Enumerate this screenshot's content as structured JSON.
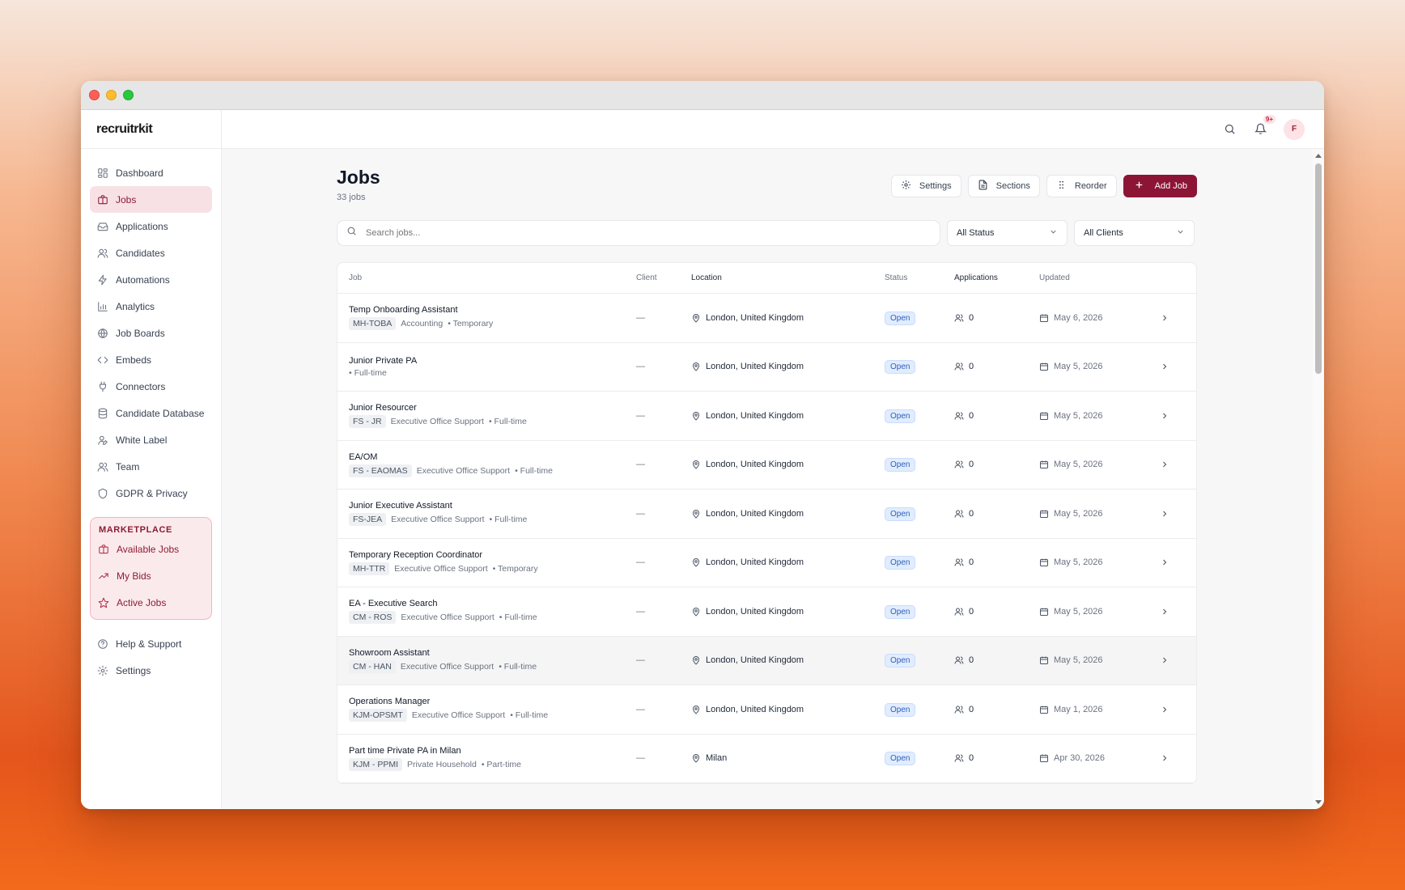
{
  "app": {
    "logo": "recruitrkit"
  },
  "sidebar": {
    "items": [
      {
        "label": "Dashboard",
        "icon": "dashboard-icon"
      },
      {
        "label": "Jobs",
        "icon": "briefcase-icon",
        "active": true
      },
      {
        "label": "Applications",
        "icon": "inbox-icon"
      },
      {
        "label": "Candidates",
        "icon": "users-icon"
      },
      {
        "label": "Automations",
        "icon": "lightning-icon"
      },
      {
        "label": "Analytics",
        "icon": "bar-chart-icon"
      },
      {
        "label": "Job Boards",
        "icon": "globe-icon"
      },
      {
        "label": "Embeds",
        "icon": "code-icon"
      },
      {
        "label": "Connectors",
        "icon": "plug-icon"
      },
      {
        "label": "Candidate Database",
        "icon": "database-icon"
      },
      {
        "label": "White Label",
        "icon": "user-pen-icon"
      },
      {
        "label": "Team",
        "icon": "team-icon"
      },
      {
        "label": "GDPR & Privacy",
        "icon": "shield-icon"
      }
    ],
    "marketplace": {
      "title": "MARKETPLACE",
      "items": [
        {
          "label": "Available Jobs",
          "icon": "briefcase-icon"
        },
        {
          "label": "My Bids",
          "icon": "trending-up-icon"
        },
        {
          "label": "Active Jobs",
          "icon": "star-icon"
        }
      ]
    },
    "bottom": [
      {
        "label": "Help & Support",
        "icon": "help-circle-icon"
      },
      {
        "label": "Settings",
        "icon": "gear-icon"
      }
    ]
  },
  "topbar": {
    "notifications_badge": "9+",
    "avatar_initial": "F"
  },
  "page": {
    "title": "Jobs",
    "subtitle": "33 jobs",
    "actions": {
      "settings": "Settings",
      "sections": "Sections",
      "reorder": "Reorder",
      "add": "Add Job"
    },
    "search_placeholder": "Search jobs...",
    "status_filter": "All Status",
    "client_filter": "All Clients"
  },
  "table": {
    "columns": {
      "job": "Job",
      "client": "Client",
      "location": "Location",
      "status": "Status",
      "applications": "Applications",
      "updated": "Updated"
    },
    "rows": [
      {
        "title": "Temp Onboarding Assistant",
        "code": "MH-TOBA",
        "category": "Accounting",
        "type": "• Temporary",
        "client": "—",
        "location": "London, United Kingdom",
        "status": "Open",
        "applications": "0",
        "updated": "May 6, 2026"
      },
      {
        "title": "Junior Private PA",
        "code": "",
        "category": "",
        "type": "• Full-time",
        "client": "—",
        "location": "London, United Kingdom",
        "status": "Open",
        "applications": "0",
        "updated": "May 5, 2026"
      },
      {
        "title": "Junior Resourcer",
        "code": "FS - JR",
        "category": "Executive Office Support",
        "type": "• Full-time",
        "client": "—",
        "location": "London, United Kingdom",
        "status": "Open",
        "applications": "0",
        "updated": "May 5, 2026"
      },
      {
        "title": "EA/OM",
        "code": "FS - EAOMAS",
        "category": "Executive Office Support",
        "type": "• Full-time",
        "client": "—",
        "location": "London, United Kingdom",
        "status": "Open",
        "applications": "0",
        "updated": "May 5, 2026"
      },
      {
        "title": "Junior Executive Assistant",
        "code": "FS-JEA",
        "category": "Executive Office Support",
        "type": "• Full-time",
        "client": "—",
        "location": "London, United Kingdom",
        "status": "Open",
        "applications": "0",
        "updated": "May 5, 2026"
      },
      {
        "title": "Temporary Reception Coordinator",
        "code": "MH-TTR",
        "category": "Executive Office Support",
        "type": "• Temporary",
        "client": "—",
        "location": "London, United Kingdom",
        "status": "Open",
        "applications": "0",
        "updated": "May 5, 2026"
      },
      {
        "title": "EA - Executive Search",
        "code": "CM - ROS",
        "category": "Executive Office Support",
        "type": "• Full-time",
        "client": "—",
        "location": "London, United Kingdom",
        "status": "Open",
        "applications": "0",
        "updated": "May 5, 2026"
      },
      {
        "title": "Showroom Assistant",
        "code": "CM - HAN",
        "category": "Executive Office Support",
        "type": "• Full-time",
        "client": "—",
        "location": "London, United Kingdom",
        "status": "Open",
        "applications": "0",
        "updated": "May 5, 2026",
        "hover": true
      },
      {
        "title": "Operations Manager",
        "code": "KJM-OPSMT",
        "category": "Executive Office Support",
        "type": "• Full-time",
        "client": "—",
        "location": "London, United Kingdom",
        "status": "Open",
        "applications": "0",
        "updated": "May 1, 2026"
      },
      {
        "title": "Part time Private PA in Milan",
        "code": "KJM - PPMI",
        "category": "Private Household",
        "type": "• Part-time",
        "client": "—",
        "location": "Milan",
        "status": "Open",
        "applications": "0",
        "updated": "Apr 30, 2026"
      }
    ]
  },
  "colors": {
    "accent": "#8c1536",
    "active_bg": "#f7e1e5",
    "status_open": "#2f5fb8"
  }
}
